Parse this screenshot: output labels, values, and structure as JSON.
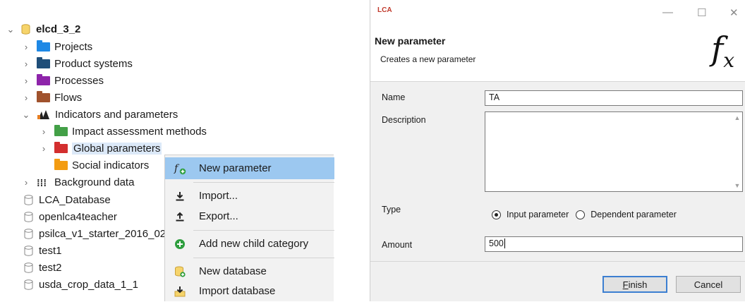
{
  "tree": {
    "root": {
      "label": "elcd_3_2"
    },
    "items": [
      {
        "label": "Projects",
        "color": "#1e88e5"
      },
      {
        "label": "Product systems",
        "color": "#1f4e79"
      },
      {
        "label": "Processes",
        "color": "#8e24aa"
      },
      {
        "label": "Flows",
        "color": "#a0522d"
      },
      {
        "label": "Indicators and parameters"
      },
      {
        "label": "Impact assessment methods",
        "color": "#43a047"
      },
      {
        "label": "Global parameters",
        "color": "#d32f2f"
      },
      {
        "label": "Social indicators",
        "color": "#f39c12"
      },
      {
        "label": "Background data"
      }
    ],
    "databases": [
      "LCA_Database",
      "openlca4teacher",
      "psilca_v1_starter_2016_02",
      "test1",
      "test2",
      "usda_crop_data_1_1"
    ]
  },
  "context_menu": {
    "items": [
      {
        "label": "New parameter",
        "icon": "fx-plus-icon"
      },
      {
        "label": "Import...",
        "icon": "import-icon"
      },
      {
        "label": "Export...",
        "icon": "export-icon"
      },
      {
        "label": "Add new child category",
        "icon": "add-circle-icon"
      },
      {
        "label": "New database",
        "icon": "new-database-icon"
      },
      {
        "label": "Import database",
        "icon": "import-database-icon"
      }
    ]
  },
  "dialog": {
    "app_logo": "LCA",
    "title": "New parameter",
    "subtitle": "Creates a new parameter",
    "fx_symbol": "f",
    "fx_sub": "x",
    "fields": {
      "name_label": "Name",
      "name_value": "TA",
      "description_label": "Description",
      "description_value": "",
      "type_label": "Type",
      "type_options": [
        "Input parameter",
        "Dependent parameter"
      ],
      "type_selected": "Input parameter",
      "amount_label": "Amount",
      "amount_value": "500"
    },
    "buttons": {
      "finish": "Finish",
      "cancel": "Cancel"
    }
  },
  "colors": {
    "menu_highlight": "#9cc8f0",
    "primary_border": "#3c7fd1"
  }
}
